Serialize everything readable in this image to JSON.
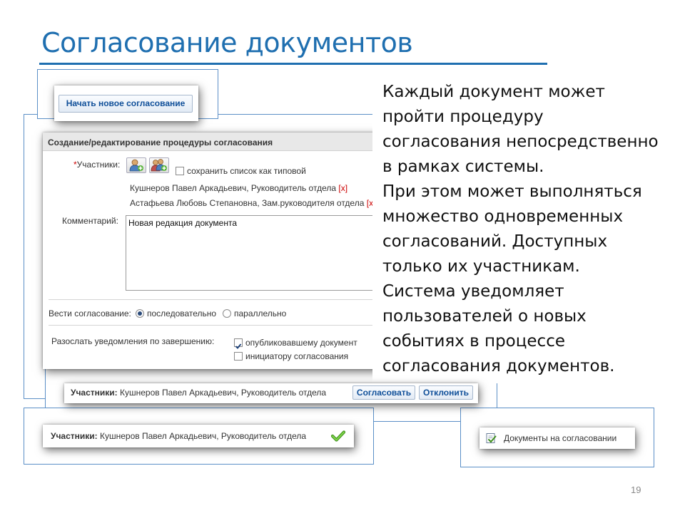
{
  "slide": {
    "title": "Согласование документов",
    "page_number": "19"
  },
  "start_button": {
    "label": "Начать новое согласование"
  },
  "approval_form": {
    "header": "Создание/редактирование процедуры согласования",
    "participants_required_mark": "*",
    "participants_label": "Участники:",
    "save_as_template_label": "сохранить список как типовой",
    "save_as_template_checked": false,
    "participants": [
      {
        "name": "Кушнеров Павел Аркадьевич, Руководитель отдела",
        "remove": "[x]"
      },
      {
        "name": "Астафьева Любовь Степановна, Зам.руководителя отдела",
        "remove": "[x]"
      }
    ],
    "comment_label": "Комментарий:",
    "comment_value": "Новая редакция документа",
    "mode_label": "Вести согласование:",
    "mode_options": [
      {
        "label": "последовательно",
        "selected": true
      },
      {
        "label": "параллельно",
        "selected": false
      }
    ],
    "notify_label": "Разослать уведомления по завершению:",
    "notify_options": [
      {
        "label": "опубликовавшему документ",
        "checked": true
      },
      {
        "label": "инициатору согласования",
        "checked": false
      }
    ]
  },
  "action_bar": {
    "participants_label": "Участники:",
    "participant": "Кушнеров Павел Аркадьевич, Руководитель отдела",
    "approve_label": "Согласовать",
    "reject_label": "Отклонить"
  },
  "approved_bar": {
    "participants_label": "Участники:",
    "participant": "Кушнеров Павел Аркадьевич, Руководитель отдела",
    "status_icon": "green-check-icon"
  },
  "documents_link": {
    "label": "Документы на согласовании",
    "icon": "document-check-icon"
  },
  "description": [
    "Каждый документ может",
    "пройти процедуру",
    "согласования непосредственно",
    "в рамках системы.",
    "При этом может выполняться",
    "множество одновременных",
    "согласований. Доступных",
    "только их участникам.",
    "Система уведомляет",
    "пользователей о новых",
    "событиях в процессе",
    "согласования документов."
  ],
  "colors": {
    "title": "#1f6fb0",
    "frame_border": "#5b8fc7",
    "button_text": "#0f4f99",
    "remove_link": "#cc0000",
    "check_green": "#5cb82a"
  }
}
